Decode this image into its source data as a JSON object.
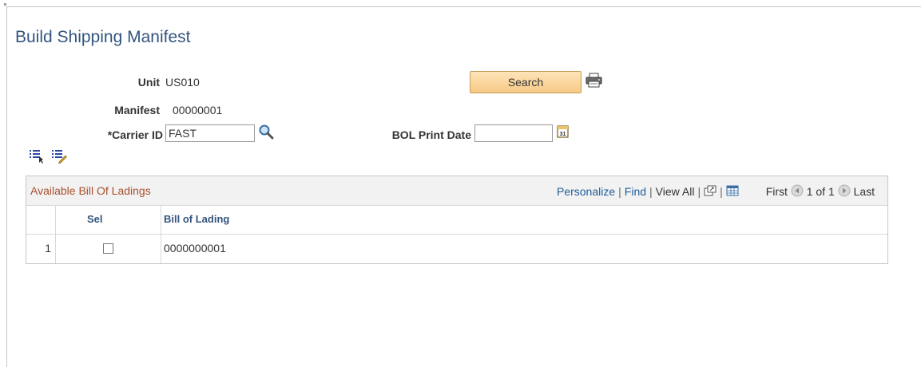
{
  "page": {
    "title": "Build Shipping Manifest"
  },
  "form": {
    "unit_label": "Unit",
    "unit_value": "US010",
    "manifest_label": "Manifest",
    "manifest_value": "00000001",
    "carrier_label": "*Carrier ID",
    "carrier_value": "FAST",
    "bol_print_date_label": "BOL Print Date",
    "bol_print_date_value": "",
    "search_button": "Search"
  },
  "icons": {
    "print": "printer-icon",
    "lookup": "magnifier-icon",
    "calendar": "calendar-icon",
    "select_all": "select-all-icon",
    "deselect_all": "deselect-all-icon",
    "zoom": "new-window-icon",
    "download": "grid-download-icon",
    "first_arrow": "arrow-left-icon",
    "last_arrow": "arrow-right-icon"
  },
  "grid": {
    "title": "Available Bill Of Ladings",
    "nav": {
      "personalize": "Personalize",
      "find": "Find",
      "view_all": "View All",
      "first": "First",
      "range": "1 of 1",
      "last": "Last"
    },
    "columns": [
      "Sel",
      "Bill of Lading"
    ],
    "rows": [
      {
        "num": "1",
        "selected": false,
        "bill_of_lading": "0000000001"
      }
    ]
  },
  "colors": {
    "title": "#33557f",
    "grid_title": "#a9502c",
    "link": "#1f5c99",
    "button": "#f7c986"
  }
}
